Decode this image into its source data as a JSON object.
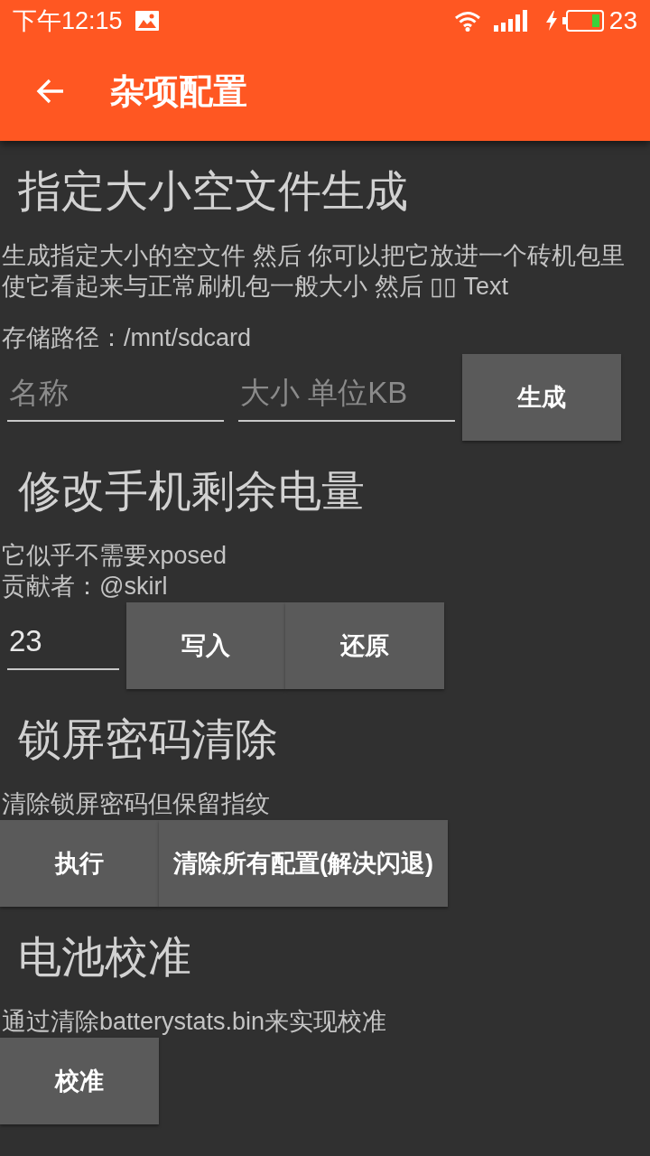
{
  "status_bar": {
    "time": "下午12:15",
    "battery": "23"
  },
  "app_bar": {
    "title": "杂项配置"
  },
  "sections": [
    {
      "title": "指定大小空文件生成",
      "paragraphs": [
        "生成指定大小的空文件 然后 你可以把它放进一个砖机包里使它看起来与正常刷机包一般大小 然后 ▯▯ Text",
        "存储路径：/mnt/sdcard"
      ],
      "controls": [
        {
          "kind": "field",
          "placeholder": "名称"
        },
        {
          "kind": "field",
          "placeholder": "大小 单位KB"
        },
        {
          "kind": "button",
          "label": "生成"
        }
      ]
    },
    {
      "title": "修改手机剩余电量",
      "paragraphs": [
        "它似乎不需要xposed\n贡献者：@skirl"
      ],
      "controls": [
        {
          "kind": "field",
          "value": "23"
        },
        {
          "kind": "button",
          "label": "写入"
        },
        {
          "kind": "button",
          "label": "还原"
        }
      ]
    },
    {
      "title": "锁屏密码清除",
      "paragraphs": [
        "清除锁屏密码但保留指纹"
      ],
      "controls": [
        {
          "kind": "button",
          "label": "执行"
        },
        {
          "kind": "button",
          "label": "清除所有配置(解决闪退)"
        }
      ]
    },
    {
      "title": "电池校准",
      "paragraphs": [
        "通过清除batterystats.bin来实现校准"
      ],
      "controls": [
        {
          "kind": "button",
          "label": "校准"
        }
      ]
    }
  ]
}
